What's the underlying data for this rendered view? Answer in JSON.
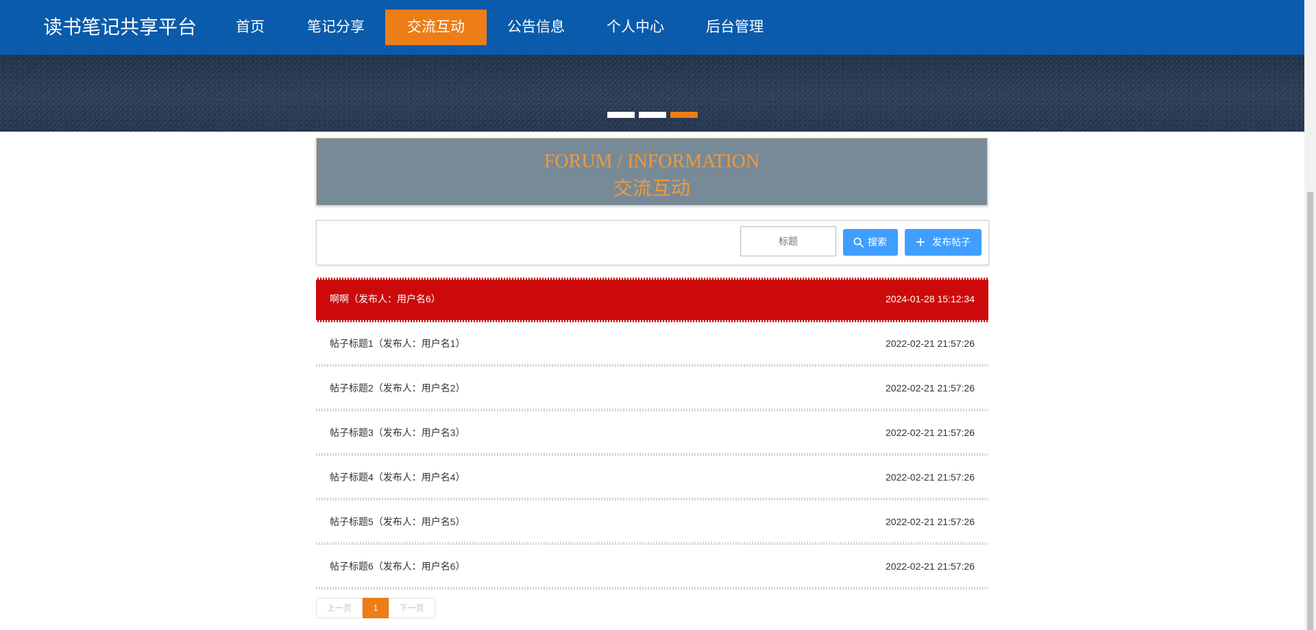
{
  "header": {
    "brand": "读书笔记共享平台",
    "nav": [
      {
        "label": "首页",
        "active": false
      },
      {
        "label": "笔记分享",
        "active": false
      },
      {
        "label": "交流互动",
        "active": true
      },
      {
        "label": "公告信息",
        "active": false
      },
      {
        "label": "个人中心",
        "active": false
      },
      {
        "label": "后台管理",
        "active": false
      }
    ]
  },
  "banner": {
    "slides_count": 3,
    "active_slide": 3
  },
  "section": {
    "title_en": "FORUM / INFORMATION",
    "title_cn": "交流互动"
  },
  "search": {
    "placeholder": "标题",
    "search_label": "搜索",
    "post_label": "发布帖子"
  },
  "posts": [
    {
      "title": "啊啊（发布人：用户名6）",
      "date": "2024-01-28 15:12:34",
      "highlighted": true
    },
    {
      "title": "帖子标题1（发布人：用户名1）",
      "date": "2022-02-21 21:57:26",
      "highlighted": false
    },
    {
      "title": "帖子标题2（发布人：用户名2）",
      "date": "2022-02-21 21:57:26",
      "highlighted": false
    },
    {
      "title": "帖子标题3（发布人：用户名3）",
      "date": "2022-02-21 21:57:26",
      "highlighted": false
    },
    {
      "title": "帖子标题4（发布人：用户名4）",
      "date": "2022-02-21 21:57:26",
      "highlighted": false
    },
    {
      "title": "帖子标题5（发布人：用户名5）",
      "date": "2022-02-21 21:57:26",
      "highlighted": false
    },
    {
      "title": "帖子标题6（发布人：用户名6）",
      "date": "2022-02-21 21:57:26",
      "highlighted": false
    }
  ],
  "pagination": {
    "prev_label": "上一页",
    "current_page": "1",
    "next_label": "下一页"
  },
  "colors": {
    "header_bg": "#0a5bab",
    "accent": "#ed7d17",
    "highlight_row": "#cc0a0a",
    "button": "#409eff",
    "title_box_bg": "#778a98",
    "title_text": "#f09a3c"
  },
  "icons": {
    "search_button": "search-icon",
    "post_button": "plus-icon"
  }
}
